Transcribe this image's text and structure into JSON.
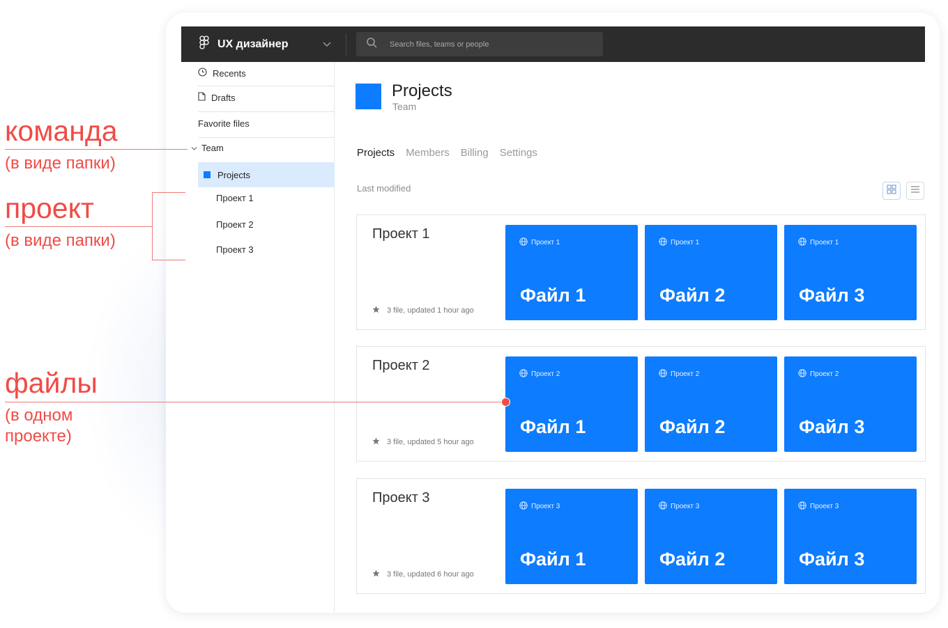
{
  "app": {
    "team_name": "UX дизайнер",
    "search_placeholder": "Search files, teams or people"
  },
  "sidebar": {
    "recents": "Recents",
    "drafts": "Drafts",
    "favorites": "Favorite files",
    "team": "Team",
    "projects": "Projects",
    "projects_list": [
      "Проект 1",
      "Проект 2",
      "Проект 3"
    ]
  },
  "header": {
    "title": "Projects",
    "subtitle": "Team"
  },
  "tabs": [
    "Projects",
    "Members",
    "Billing",
    "Settings"
  ],
  "sort_label": "Last modified",
  "projects": [
    {
      "name": "Проект 1",
      "meta": "3 file, updated 1 hour ago",
      "files": [
        {
          "project": "Проект 1",
          "name": "Файл 1"
        },
        {
          "project": "Проект 1",
          "name": "Файл 2"
        },
        {
          "project": "Проект 1",
          "name": "Файл 3"
        }
      ]
    },
    {
      "name": "Проект 2",
      "meta": "3 file, updated 5 hour ago",
      "files": [
        {
          "project": "Проект 2",
          "name": "Файл 1"
        },
        {
          "project": "Проект 2",
          "name": "Файл 2"
        },
        {
          "project": "Проект 2",
          "name": "Файл 3"
        }
      ]
    },
    {
      "name": "Проект 3",
      "meta": "3 file, updated 6 hour ago",
      "files": [
        {
          "project": "Проект 3",
          "name": "Файл 1"
        },
        {
          "project": "Проект 3",
          "name": "Файл 2"
        },
        {
          "project": "Проект 3",
          "name": "Файл 3"
        }
      ]
    }
  ],
  "annotations": {
    "team_title": "команда",
    "team_note": "(в виде папки)",
    "project_title": "проект",
    "project_note": "(в виде папки)",
    "files_title": "файлы",
    "files_note_1": "(в одном",
    "files_note_2": "проекте)"
  },
  "colors": {
    "accent": "#0d7cff",
    "annotation": "#f04b46",
    "topbar": "#2c2c2c"
  }
}
